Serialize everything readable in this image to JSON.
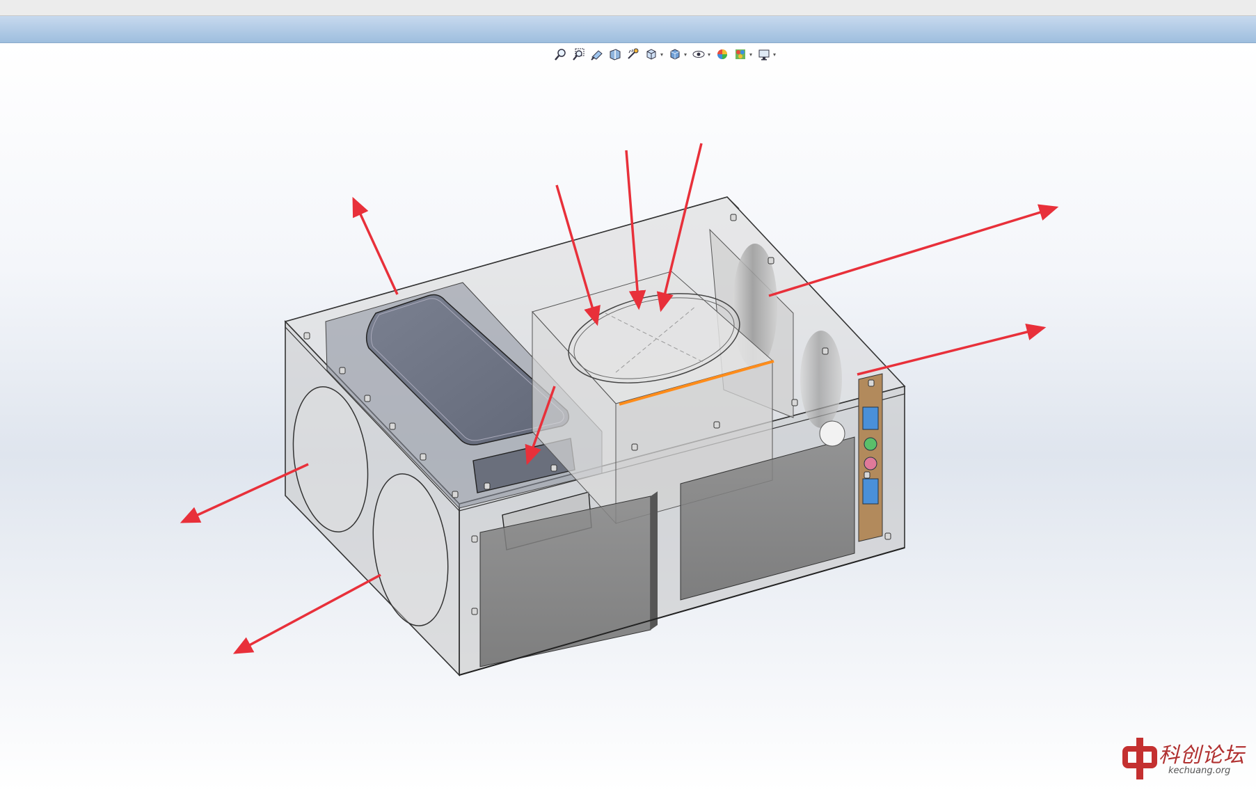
{
  "app": {
    "window": "SolidWorks 3D model viewport"
  },
  "heads_up_toolbar": {
    "tools": [
      {
        "name": "zoom-to-fit"
      },
      {
        "name": "zoom-to-area"
      },
      {
        "name": "previous-view"
      },
      {
        "name": "section-view"
      },
      {
        "name": "dynamic-annotation-views"
      },
      {
        "name": "view-orientation",
        "dropdown": true
      },
      {
        "name": "display-style",
        "dropdown": true
      },
      {
        "name": "hide-show-items",
        "dropdown": true
      },
      {
        "name": "edit-appearance"
      },
      {
        "name": "apply-scene",
        "dropdown": true
      },
      {
        "name": "view-settings",
        "dropdown": true
      }
    ]
  },
  "model": {
    "description": "transparent enclosure with fans, PSU, heatsink, front I/O",
    "edge_highlight_color": "#ff8c1a",
    "arrow_color": "#e8303a"
  },
  "watermark": {
    "chinese": "科创论坛",
    "english": "kechuang.org"
  },
  "colors": {
    "viewport_top": "#ffffff",
    "viewport_mid": "#dfe5ee",
    "title_strip": "#a9c4e2"
  }
}
